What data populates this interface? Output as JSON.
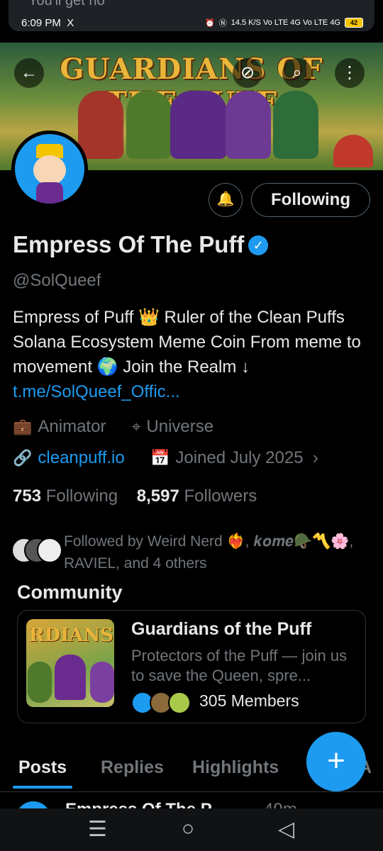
{
  "notification_peek": "You'll get no",
  "status_bar": {
    "time": "6:09 PM",
    "app_icon": "X",
    "network": "14.5 K/S  Vo LTE 4G  Vo LTE 4G",
    "battery": "42"
  },
  "banner": {
    "title_art": "GUARDIANS OF THE PUFF"
  },
  "header_buttons": {
    "back": "←",
    "hide": "⊘",
    "search": "⌕",
    "more": "⋮"
  },
  "profile": {
    "name": "Empress Of The Puff",
    "handle": "@SolQueef",
    "bio_text": "Empress of Puff 👑 Ruler of the Clean Puffs Solana Ecosystem Meme Coin From meme to movement 🌍 Join the Realm ↓",
    "bio_link": "t.me/SolQueef_Offic...",
    "category": "Animator",
    "location": "Universe",
    "website": "cleanpuff.io",
    "joined": "Joined July 2025",
    "following_count": "753",
    "following_label": "Following",
    "followers_count": "8,597",
    "followers_label": "Followers",
    "followed_by": "Followed by Weird Nerd ❤️‍🔥, 𝒌𝒐𝒎𝒆🪖〽️🌸, RAVIEL, and 4 others"
  },
  "buttons": {
    "notify_icon": "🔔",
    "follow_state": "Following"
  },
  "community": {
    "heading": "Community",
    "name": "Guardians of the Puff",
    "description": "Protectors of the Puff — join us to save the Queen, spre...",
    "members": "305 Members",
    "thumb_text": "RDIANS"
  },
  "tabs": [
    "Posts",
    "Replies",
    "Highlights",
    "A"
  ],
  "peek_post": {
    "name": "Empress Of The P",
    "time": "49m"
  },
  "fab": "+",
  "nav": {
    "recents": "☰",
    "home": "○",
    "back": "◁"
  },
  "colors": {
    "accent": "#1d9bf0",
    "background": "#000000",
    "muted": "#71767b"
  }
}
